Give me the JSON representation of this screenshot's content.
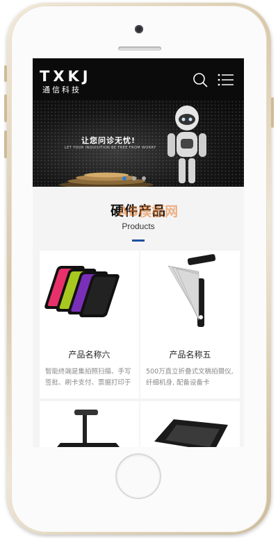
{
  "header": {
    "logo_main": "TXKJ",
    "logo_sub": "通信科技"
  },
  "banner": {
    "title": "让您问诊无忧!",
    "subtitle": "LET YOUR INQUISITION BE FREE FROM WORRY",
    "active_slide": 1,
    "slide_count": 3
  },
  "section": {
    "title": "硬件产品",
    "subtitle": "Products"
  },
  "products": [
    {
      "name": "产品名称六",
      "desc": "智能终端是集拍照扫描、手写签批、刷卡支付、票据打印于"
    },
    {
      "name": "产品名称五",
      "desc": "500万直立折叠式文稿拍摄仪, 纤细机身, 配备设备卡"
    },
    {
      "name": "",
      "desc": ""
    },
    {
      "name": "",
      "desc": ""
    }
  ],
  "watermark": "AB模板网",
  "colors": {
    "accent": "#1f4fa0",
    "header_bg": "#0b0b0b",
    "slide_dot_active": "#2a7fd4"
  }
}
